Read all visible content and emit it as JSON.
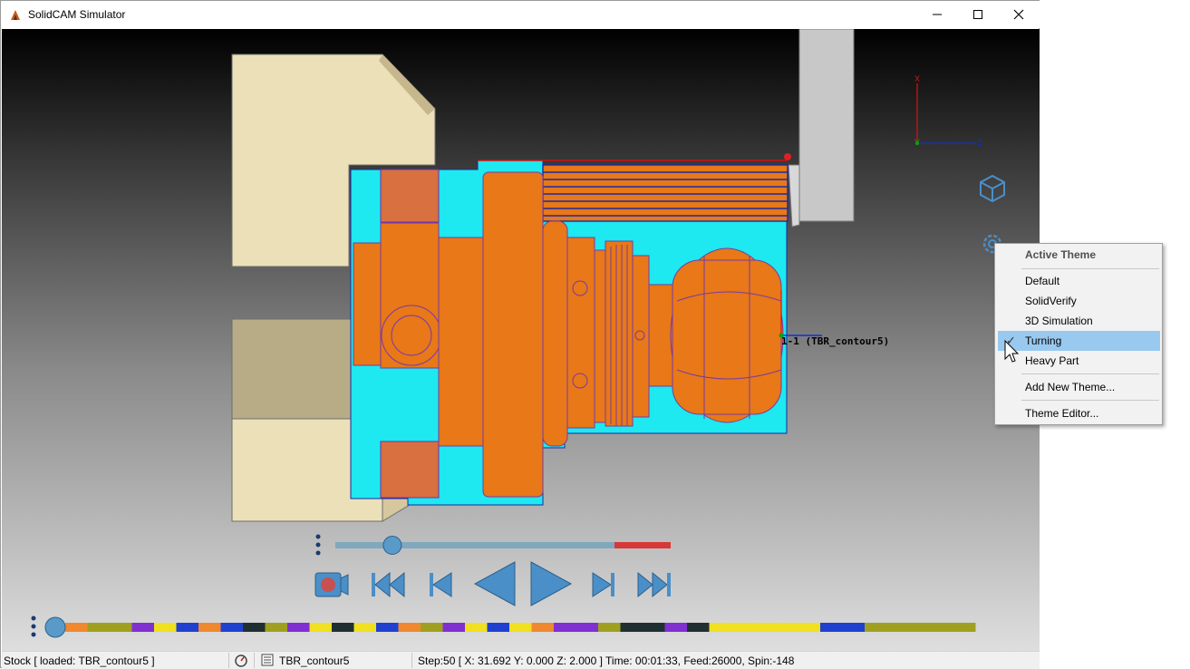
{
  "window": {
    "title": "SolidCAM Simulator"
  },
  "viewport": {
    "tool_label": "1-1 (TBR_contour5)",
    "axis": {
      "x": "X",
      "y": "Y",
      "z": "Z"
    }
  },
  "playback": {
    "speed_level": 0.17,
    "progress_level": 0.0
  },
  "theme_menu": {
    "header": "Active Theme",
    "items": [
      "Default",
      "SolidVerify",
      "3D Simulation",
      "Turning",
      "Heavy Part"
    ],
    "selected": "Turning",
    "add_new": "Add New Theme...",
    "editor": "Theme Editor..."
  },
  "statusbar": {
    "stock": "Stock [ loaded:  TBR_contour5 ]",
    "operation": "TBR_contour5",
    "info": "Step:50 [ X: 31.692 Y: 0.000 Z: 2.000 ] Time: 00:01:33, Feed:26000, Spin:-148"
  },
  "colors": {
    "part_orange": "#e87818",
    "stock_cyan": "#1ee8f0",
    "chuck_beige": "#ece0b8",
    "button_blue": "#4a8fc8",
    "selection": "#99c9ef"
  }
}
